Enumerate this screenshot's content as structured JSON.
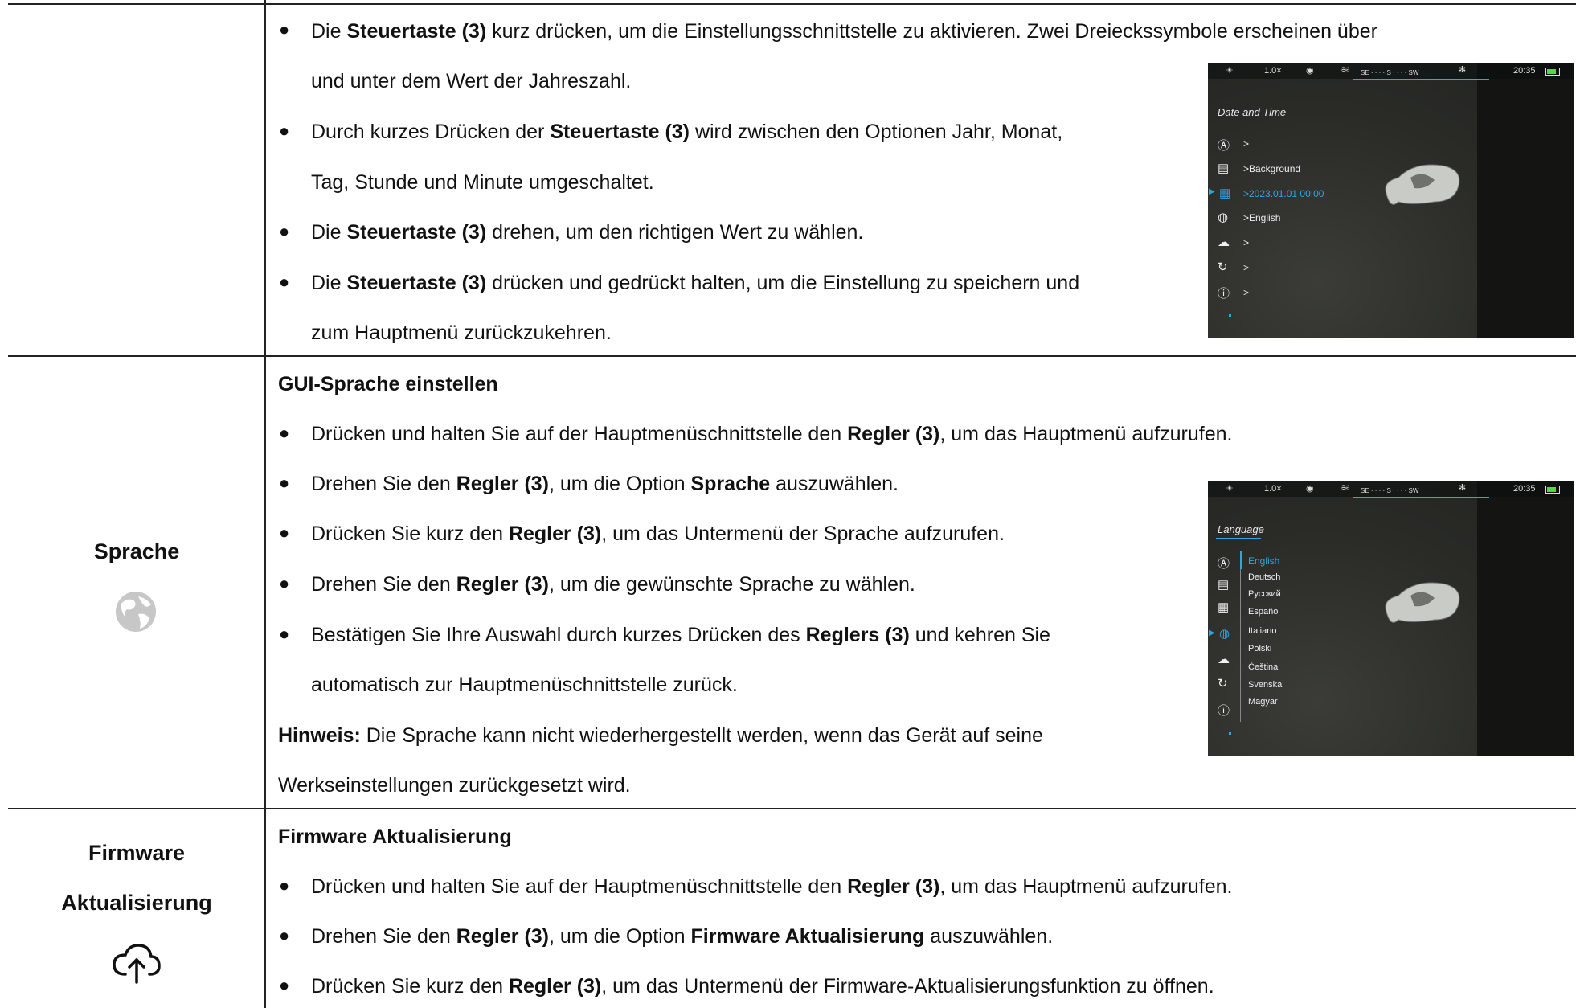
{
  "row1": {
    "b1": {
      "pre": "Die ",
      "bold": "Steuertaste (3)",
      "post": " kurz drücken, um die Einstellungsschnittstelle zu aktivieren.   Zwei Dreieckssymbole erscheinen über"
    },
    "b1_cont": "und unter dem Wert der Jahreszahl.",
    "b2": {
      "pre": "Durch kurzes Drücken der ",
      "bold": "Steuertaste (3)",
      "post": " wird zwischen den Optionen Jahr, Monat,"
    },
    "b2_cont": "Tag, Stunde und Minute umgeschaltet.",
    "b3": {
      "pre": "Die ",
      "bold": "Steuertaste (3)",
      "post": " drehen, um den richtigen Wert zu wählen."
    },
    "b4": {
      "pre": "Die ",
      "bold": "Steuertaste (3)",
      "post": " drücken und gedrückt halten, um die Einstellung zu speichern und"
    },
    "b4_cont": "zum Hauptmenü zurückzukehren.",
    "screen": {
      "zoom": "1.0×",
      "compass": "SE · · · · S · · · · SW",
      "time": "20:35",
      "title": "Date and Time",
      "items": [
        ">",
        ">Background",
        ">2023.01.01  00:00",
        ">English",
        ">",
        ">",
        ">"
      ]
    }
  },
  "row2": {
    "label": "Sprache",
    "heading": "GUI-Sprache einstellen",
    "b1": {
      "pre": "Drücken und halten Sie auf der Hauptmenüschnittstelle den ",
      "bold": "Regler (3)",
      "post": ", um das Hauptmenü aufzurufen."
    },
    "b2": {
      "pre": "Drehen Sie den ",
      "bold": "Regler (3)",
      "mid": ", um die Option ",
      "bold2": "Sprache",
      "post": " auszuwählen."
    },
    "b3": {
      "pre": "Drücken Sie kurz den ",
      "bold": "Regler (3)",
      "post": ", um das Untermenü der Sprache aufzurufen."
    },
    "b4": {
      "pre": "Drehen Sie den ",
      "bold": "Regler (3)",
      "post": ", um die gewünschte Sprache zu wählen."
    },
    "b5": {
      "pre": "Bestätigen Sie Ihre Auswahl durch kurzes Drücken des ",
      "bold": "Reglers (3)",
      "post": " und kehren Sie"
    },
    "b5_cont": "automatisch zur Hauptmenüschnittstelle zurück.",
    "note_bold": "Hinweis:",
    "note": " Die Sprache kann nicht wiederhergestellt werden, wenn das Gerät auf seine",
    "note_cont": "Werkseinstellungen zurückgesetzt wird.",
    "screen": {
      "zoom": "1.0×",
      "compass": "SE · · · · S · · · · SW",
      "time": "20:35",
      "title": "Language",
      "languages": [
        "English",
        "Deutsch",
        "Русский",
        "Español",
        "Italiano",
        "Polski",
        "Čeština",
        "Svenska",
        "Magyar"
      ]
    }
  },
  "row3": {
    "label1": "Firmware",
    "label2": "Aktualisierung",
    "heading": "Firmware Aktualisierung",
    "b1": {
      "pre": "Drücken und halten Sie auf der Hauptmenüschnittstelle den ",
      "bold": "Regler (3)",
      "post": ", um das Hauptmenü aufzurufen."
    },
    "b2": {
      "pre": "Drehen Sie den ",
      "bold": "Regler (3)",
      "mid": ", um die Option ",
      "bold2": "Firmware Aktualisierung",
      "post": " auszuwählen."
    },
    "b3": {
      "pre": "Drücken Sie kurz den ",
      "bold": "Regler (3)",
      "post": ", um das Untermenü der Firmware-Aktualisierungsfunktion zu öffnen."
    }
  },
  "colors": {
    "accent": "#2ea7e0",
    "rule": "#222222",
    "screen_bg": "#2b2c28"
  }
}
